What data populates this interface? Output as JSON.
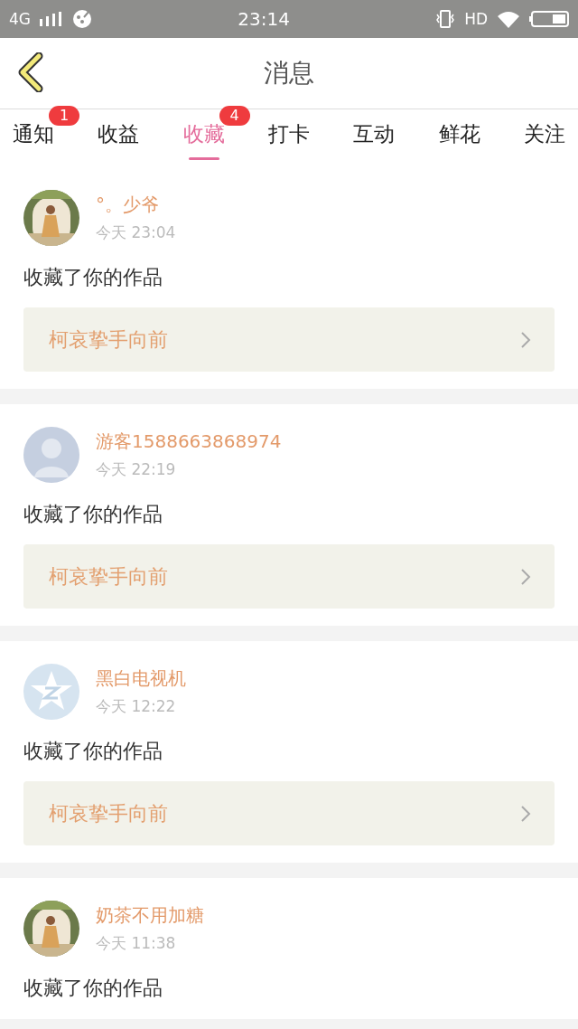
{
  "status_bar": {
    "network": "4G",
    "time": "23:14",
    "hd": "HD"
  },
  "header": {
    "title": "消息"
  },
  "tabs": [
    {
      "label": "通知",
      "selected": false,
      "badge": "1"
    },
    {
      "label": "收益",
      "selected": false
    },
    {
      "label": "收藏",
      "selected": true,
      "badge": "4"
    },
    {
      "label": "打卡",
      "selected": false
    },
    {
      "label": "互动",
      "selected": false
    },
    {
      "label": "鲜花",
      "selected": false
    },
    {
      "label": "关注",
      "selected": false
    }
  ],
  "messages": [
    {
      "kind": "picture",
      "name": "°。少爷",
      "time": "今天 23:04",
      "text": "收藏了你的作品",
      "work": "柯哀挚手向前"
    },
    {
      "kind": "silhouette",
      "name": "游客1588663868974",
      "time": "今天 22:19",
      "text": "收藏了你的作品",
      "work": "柯哀挚手向前"
    },
    {
      "kind": "star",
      "name": "黑白电视机",
      "time": "今天 12:22",
      "text": "收藏了你的作品",
      "work": "柯哀挚手向前"
    },
    {
      "kind": "picture",
      "name": "奶茶不用加糖",
      "time": "今天 11:38",
      "text": "收藏了你的作品"
    }
  ]
}
